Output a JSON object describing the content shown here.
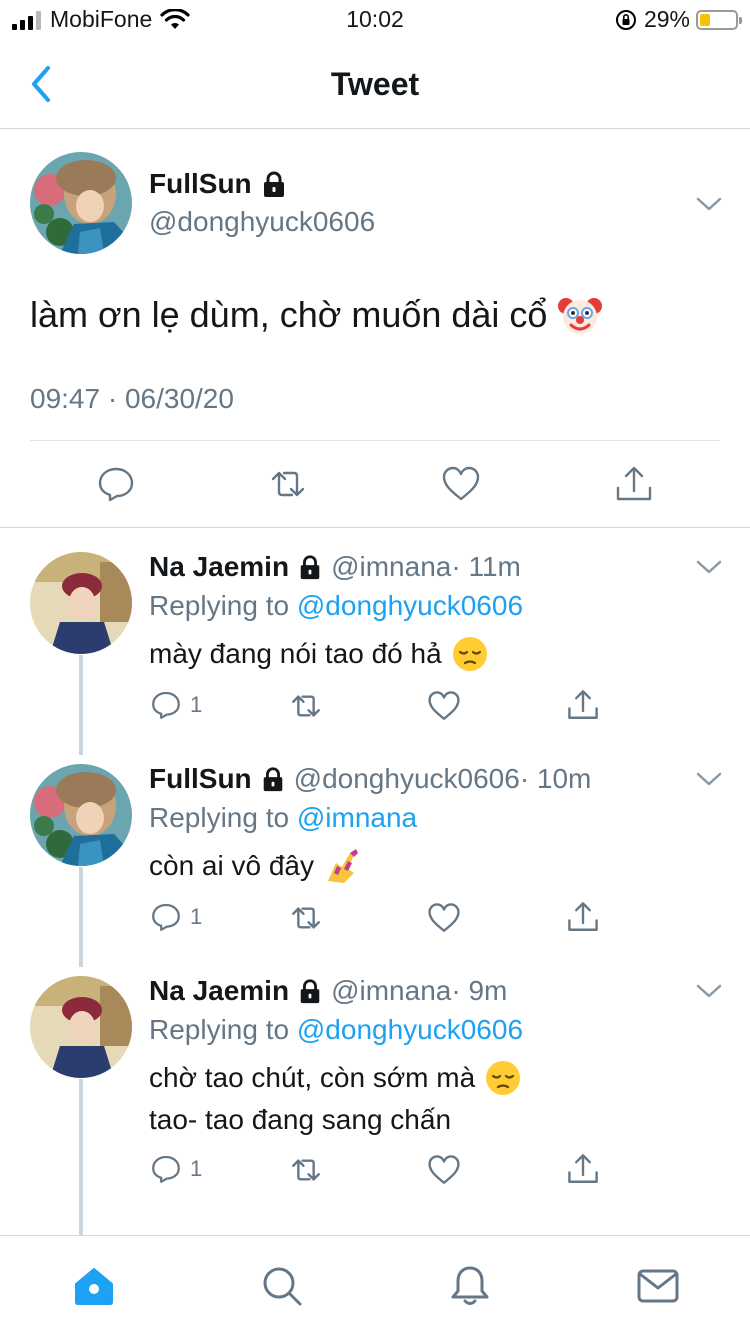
{
  "status_bar": {
    "carrier": "MobiFone",
    "time": "10:02",
    "battery_percent": "29%",
    "battery_level": 0.29,
    "icons": [
      "signal-icon",
      "wifi-icon",
      "orientation-lock-icon",
      "battery-icon"
    ]
  },
  "nav": {
    "title": "Tweet",
    "back_icon": "chevron-left-icon"
  },
  "main_tweet": {
    "name": "FullSun",
    "handle": "@donghyuck0606",
    "text": "làm ơn lẹ dùm, chờ muốn dài cổ",
    "emoji": "clown-face-emoji",
    "timestamp": "09:47 · 06/30/20",
    "actions": [
      "reply-icon",
      "retweet-icon",
      "like-icon",
      "share-icon"
    ]
  },
  "replies": [
    {
      "name": "Na Jaemin",
      "handle": "@imnana",
      "meta": "· 11m",
      "replying_prefix": "Replying to",
      "replying_to": "@donghyuck0606",
      "lines": [
        "mày đang nói tao đó hả"
      ],
      "emoji": "pensive-face-emoji",
      "reply_count": "1"
    },
    {
      "name": "FullSun",
      "handle": "@donghyuck0606",
      "meta": "· 10m",
      "replying_prefix": "Replying to",
      "replying_to": "@imnana",
      "lines": [
        "còn ai vô đây"
      ],
      "emoji": "nail-polish-emoji",
      "reply_count": "1"
    },
    {
      "name": "Na Jaemin",
      "handle": "@imnana",
      "meta": "· 9m",
      "replying_prefix": "Replying to",
      "replying_to": "@donghyuck0606",
      "lines": [
        "chờ tao chút, còn sớm mà",
        "tao- tao đang sang chấn"
      ],
      "emoji": "pensive-face-emoji",
      "reply_count": "1"
    }
  ],
  "tabbar": {
    "tabs": [
      "home-icon",
      "search-icon",
      "notifications-icon",
      "messages-icon"
    ],
    "active": "home-icon",
    "accent": "#1da1f2"
  },
  "colors": {
    "accent": "#1da1f2",
    "secondary_text": "#657786",
    "divider": "#d6d9db"
  }
}
